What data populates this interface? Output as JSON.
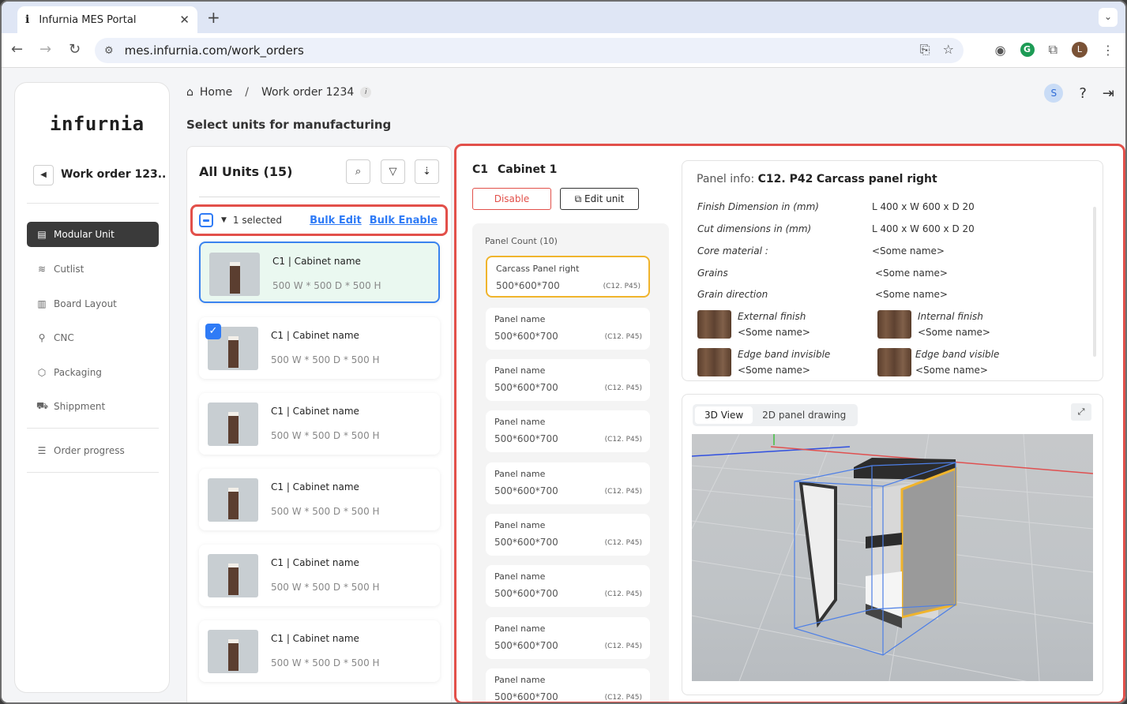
{
  "browser": {
    "tab_title": "Infurnia MES Portal",
    "tab_favicon": "i",
    "url": "mes.infurnia.com/work_orders",
    "profile_initial": "L"
  },
  "sidebar": {
    "logo": "infurnia",
    "work_order_title": "Work order 123..",
    "items": [
      {
        "label": "Modular Unit",
        "icon": "modular-unit-icon",
        "active": true
      },
      {
        "label": "Cutlist",
        "icon": "cutlist-icon",
        "active": false
      },
      {
        "label": "Board Layout",
        "icon": "board-layout-icon",
        "active": false
      },
      {
        "label": "CNC",
        "icon": "cnc-icon",
        "active": false
      },
      {
        "label": "Packaging",
        "icon": "packaging-icon",
        "active": false
      },
      {
        "label": "Shippment",
        "icon": "shipment-icon",
        "active": false
      }
    ],
    "order_progress": "Order progress"
  },
  "header": {
    "breadcrumb_home": "Home",
    "breadcrumb_sep": "/",
    "breadcrumb_current": "Work order 1234",
    "page_title": "Select units for manufacturing",
    "user_initial": "S"
  },
  "units": {
    "title": "All Units (15)",
    "selected_text": "1 selected",
    "bulk_edit": "Bulk Edit",
    "bulk_enable": "Bulk Enable",
    "cards": [
      {
        "name": "C1 | Cabinet name",
        "dims": "500 W * 500 D * 500 H",
        "selected": true,
        "checked": false
      },
      {
        "name": "C1 | Cabinet name",
        "dims": "500 W * 500 D * 500 H",
        "selected": false,
        "checked": true
      },
      {
        "name": "C1 | Cabinet name",
        "dims": "500 W * 500 D * 500 H",
        "selected": false,
        "checked": false
      },
      {
        "name": "C1 | Cabinet name",
        "dims": "500 W * 500 D * 500 H",
        "selected": false,
        "checked": false
      },
      {
        "name": "C1 | Cabinet name",
        "dims": "500 W * 500 D * 500 H",
        "selected": false,
        "checked": false
      },
      {
        "name": "C1 | Cabinet name",
        "dims": "500 W * 500 D * 500 H",
        "selected": false,
        "checked": false
      }
    ]
  },
  "detail": {
    "cabinet_code": "C1",
    "cabinet_name": "Cabinet 1",
    "disable_label": "Disable",
    "edit_label": "Edit unit",
    "panel_count": "Panel Count (10)",
    "panels": [
      {
        "name": "Carcass Panel right",
        "dims": "500*600*700",
        "code": "(C12. P45)",
        "selected": true
      },
      {
        "name": "Panel name",
        "dims": "500*600*700",
        "code": "(C12. P45)",
        "selected": false
      },
      {
        "name": "Panel name",
        "dims": "500*600*700",
        "code": "(C12. P45)",
        "selected": false
      },
      {
        "name": "Panel name",
        "dims": "500*600*700",
        "code": "(C12. P45)",
        "selected": false
      },
      {
        "name": "Panel name",
        "dims": "500*600*700",
        "code": "(C12. P45)",
        "selected": false
      },
      {
        "name": "Panel name",
        "dims": "500*600*700",
        "code": "(C12. P45)",
        "selected": false
      },
      {
        "name": "Panel name",
        "dims": "500*600*700",
        "code": "(C12. P45)",
        "selected": false
      },
      {
        "name": "Panel name",
        "dims": "500*600*700",
        "code": "(C12. P45)",
        "selected": false
      },
      {
        "name": "Panel name",
        "dims": "500*600*700",
        "code": "(C12. P45)",
        "selected": false
      }
    ],
    "panel_info": {
      "title_prefix": "Panel info:",
      "title_code": "C12. P42",
      "title_name": "Carcass panel right",
      "rows": [
        {
          "label": "Finish Dimension in (mm)",
          "value": "L 400 x W 600 x D 20"
        },
        {
          "label": "Cut dimensions in (mm)",
          "value": "L 400 x W 600 x D 20"
        },
        {
          "label": "Core material :",
          "value": "<Some name>"
        },
        {
          "label": "Grains",
          "value": "<Some name>"
        },
        {
          "label": "Grain direction",
          "value": "<Some name>"
        }
      ],
      "finishes": [
        {
          "label": "External finish",
          "value": "<Some name>"
        },
        {
          "label": "Internal finish",
          "value": "<Some name>"
        },
        {
          "label": "Edge band invisible",
          "value": "<Some name>"
        },
        {
          "label": "Edge band visible",
          "value": "<Some name>"
        }
      ]
    },
    "view_tabs": [
      "3D View",
      "2D panel drawing"
    ],
    "active_view": "3D View"
  },
  "colors": {
    "accent_blue": "#2f7bf6",
    "alert_red": "#e2504a",
    "highlight_orange": "#f0b42c"
  }
}
